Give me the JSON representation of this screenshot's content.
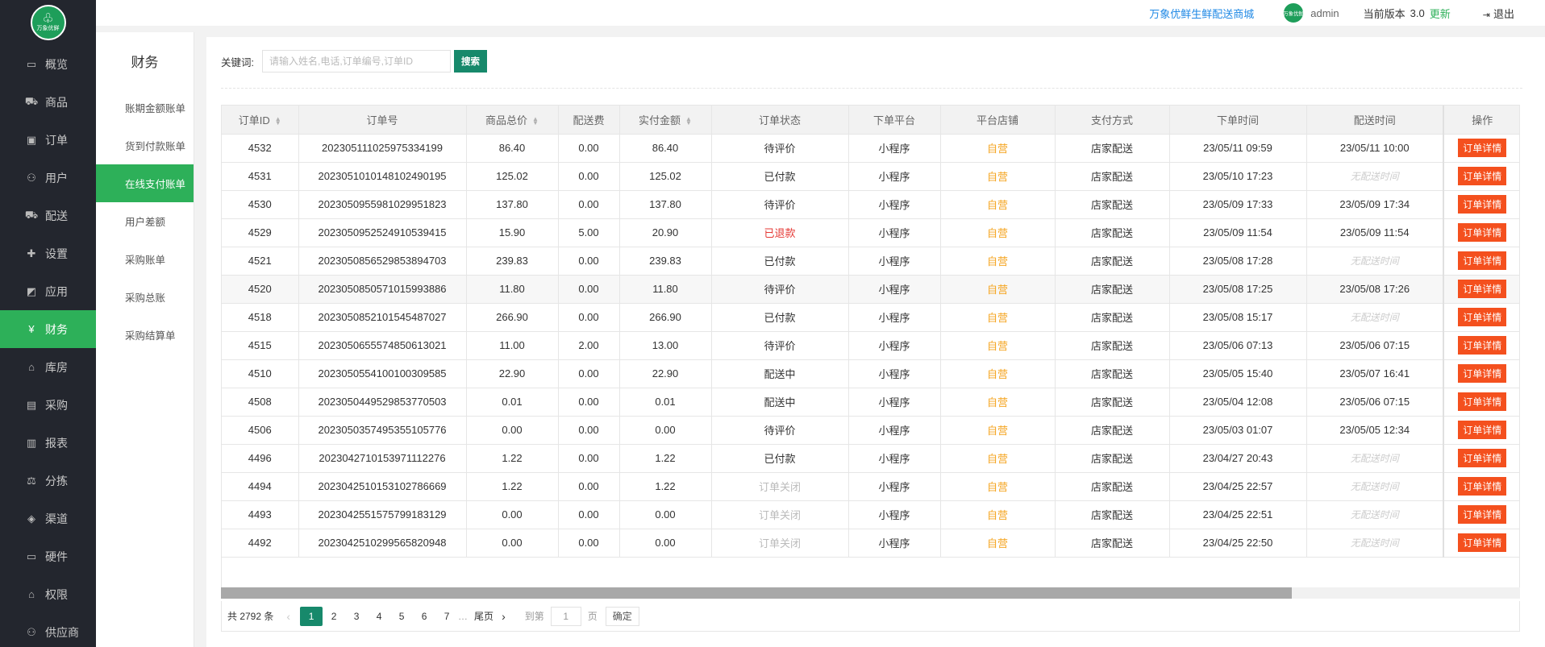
{
  "logo": {
    "text": "万象优鲜"
  },
  "topbar": {
    "shop_name": "万象优鲜生鲜配送商城",
    "avatar_text": "万象优鲜",
    "username": "admin",
    "version_label": "当前版本",
    "version": "3.0",
    "update": "更新",
    "logout": "退出"
  },
  "nav": {
    "items": [
      {
        "label": "概览",
        "icon": "monitor-icon"
      },
      {
        "label": "商品",
        "icon": "cart-icon"
      },
      {
        "label": "订单",
        "icon": "money-icon"
      },
      {
        "label": "用户",
        "icon": "users-icon"
      },
      {
        "label": "配送",
        "icon": "truck-icon"
      },
      {
        "label": "设置",
        "icon": "puzzle-icon"
      },
      {
        "label": "应用",
        "icon": "apps-icon"
      },
      {
        "label": "财务",
        "icon": "yen-icon"
      },
      {
        "label": "库房",
        "icon": "home-icon"
      },
      {
        "label": "采购",
        "icon": "hdd-icon"
      },
      {
        "label": "报表",
        "icon": "bar-chart-icon"
      },
      {
        "label": "分拣",
        "icon": "scale-icon"
      },
      {
        "label": "渠道",
        "icon": "cube-icon"
      },
      {
        "label": "硬件",
        "icon": "desktop-icon"
      },
      {
        "label": "权限",
        "icon": "bank-icon"
      },
      {
        "label": "供应商",
        "icon": "group-icon"
      }
    ],
    "active": "财务"
  },
  "submenu": {
    "title": "财务",
    "items": [
      "账期金额账单",
      "货到付款账单",
      "在线支付账单",
      "用户差额",
      "采购账单",
      "采购总账",
      "采购结算单"
    ],
    "active": "在线支付账单"
  },
  "search": {
    "label": "关键词:",
    "placeholder": "请输入姓名,电话,订单编号,订单ID",
    "button": "搜索"
  },
  "table": {
    "columns": [
      "订单ID",
      "订单号",
      "商品总价",
      "配送费",
      "实付金额",
      "订单状态",
      "下单平台",
      "平台店铺",
      "支付方式",
      "下单时间",
      "配送时间",
      "操作"
    ],
    "detail_label": "订单详情",
    "no_time_label": "无配送时间",
    "rows": [
      [
        "4532",
        "202305111025975334199",
        "86.40",
        "0.00",
        "86.40",
        "待评价",
        "小程序",
        "自营",
        "店家配送",
        "23/05/11 09:59",
        "23/05/11 10:00"
      ],
      [
        "4531",
        "202305101014810249019​5",
        "125.02",
        "0.00",
        "125.02",
        "已付款",
        "小程序",
        "自营",
        "店家配送",
        "23/05/10 17:23",
        ""
      ],
      [
        "4530",
        "202305095598102995182​3",
        "137.80",
        "0.00",
        "137.80",
        "待评价",
        "小程序",
        "自营",
        "店家配送",
        "23/05/09 17:33",
        "23/05/09 17:34"
      ],
      [
        "4529",
        "202305095252491053941​5",
        "15.90",
        "5.00",
        "20.90",
        "已退款",
        "小程序",
        "自营",
        "店家配送",
        "23/05/09 11:54",
        "23/05/09 11:54"
      ],
      [
        "4521",
        "202305085652985389470​3",
        "239.83",
        "0.00",
        "239.83",
        "已付款",
        "小程序",
        "自营",
        "店家配送",
        "23/05/08 17:28",
        ""
      ],
      [
        "4520",
        "202305085057101599388​6",
        "11.80",
        "0.00",
        "11.80",
        "待评价",
        "小程序",
        "自营",
        "店家配送",
        "23/05/08 17:25",
        "23/05/08 17:26"
      ],
      [
        "4518",
        "202305085210154548702​7",
        "266.90",
        "0.00",
        "266.90",
        "已付款",
        "小程序",
        "自营",
        "店家配送",
        "23/05/08 15:17",
        ""
      ],
      [
        "4515",
        "202305065557485061302​1",
        "11.00",
        "2.00",
        "13.00",
        "待评价",
        "小程序",
        "自营",
        "店家配送",
        "23/05/06 07:13",
        "23/05/06 07:15"
      ],
      [
        "4510",
        "202305055410010030958​5",
        "22.90",
        "0.00",
        "22.90",
        "配送中",
        "小程序",
        "自营",
        "店家配送",
        "23/05/05 15:40",
        "23/05/07 16:41"
      ],
      [
        "4508",
        "202305044952985377050​3",
        "0.01",
        "0.00",
        "0.01",
        "配送中",
        "小程序",
        "自营",
        "店家配送",
        "23/05/04 12:08",
        "23/05/06 07:15"
      ],
      [
        "4506",
        "202305035749535510577​6",
        "0.00",
        "0.00",
        "0.00",
        "待评价",
        "小程序",
        "自营",
        "店家配送",
        "23/05/03 01:07",
        "23/05/05 12:34"
      ],
      [
        "4496",
        "202304271015397111227​6",
        "1.22",
        "0.00",
        "1.22",
        "已付款",
        "小程序",
        "自营",
        "店家配送",
        "23/04/27 20:43",
        ""
      ],
      [
        "4494",
        "202304251015310278666​9",
        "1.22",
        "0.00",
        "1.22",
        "订单关闭",
        "小程序",
        "自营",
        "店家配送",
        "23/04/25 22:57",
        ""
      ],
      [
        "4493",
        "202304255157579918312​9",
        "0.00",
        "0.00",
        "0.00",
        "订单关闭",
        "小程序",
        "自营",
        "店家配送",
        "23/04/25 22:51",
        ""
      ],
      [
        "4492",
        "202304251029956582094​8",
        "0.00",
        "0.00",
        "0.00",
        "订单关闭",
        "小程序",
        "自营",
        "店家配送",
        "23/04/25 22:50",
        ""
      ]
    ]
  },
  "pager": {
    "total": "共 2792 条",
    "pages": [
      "1",
      "2",
      "3",
      "4",
      "5",
      "6",
      "7"
    ],
    "current": "1",
    "ellipsis": "…",
    "last": "尾页",
    "goto": "到第",
    "goto_value": "1",
    "page_unit": "页",
    "confirm": "确定"
  },
  "colors": {
    "accent": "#2db059",
    "button": "#17896b",
    "danger": "#f4501e",
    "self": "#f5a623"
  }
}
